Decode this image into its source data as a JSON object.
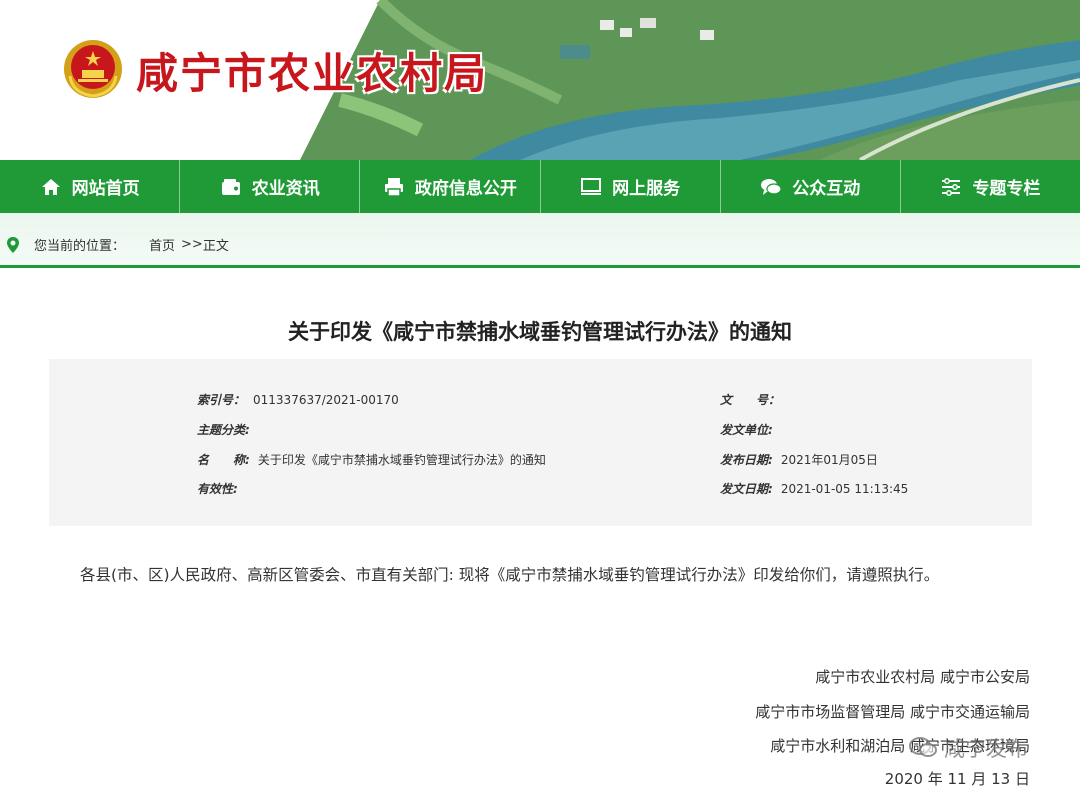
{
  "site": {
    "title": "咸宁市农业农村局"
  },
  "nav": [
    {
      "label": "网站首页",
      "icon": "home-icon"
    },
    {
      "label": "农业资讯",
      "icon": "wallet-icon"
    },
    {
      "label": "政府信息公开",
      "icon": "printer-icon"
    },
    {
      "label": "网上服务",
      "icon": "monitor-icon"
    },
    {
      "label": "公众互动",
      "icon": "chat-icon"
    },
    {
      "label": "专题专栏",
      "icon": "sliders-icon"
    }
  ],
  "breadcrumb": {
    "prefix": "您当前的位置：",
    "home": "首页",
    "separator": ">>",
    "current": "正文"
  },
  "article": {
    "title": "关于印发《咸宁市禁捕水域垂钓管理试行办法》的通知",
    "meta": {
      "index_label": "索引号：",
      "index_value": "011337637/2021-00170",
      "topic_label": "主题分类:",
      "topic_value": "",
      "name_label": "名　　称:",
      "name_value": "关于印发《咸宁市禁捕水域垂钓管理试行办法》的通知",
      "validity_label": "有效性:",
      "validity_value": "",
      "doc_no_label": "文　　号：",
      "doc_no_value": "",
      "issuer_label": "发文单位:",
      "issuer_value": "",
      "publish_label": "发布日期:",
      "publish_value": "2021年01月05日",
      "issue_date_label": "发文日期:",
      "issue_date_value": "2021-01-05 11:13:45"
    },
    "body": "各县(市、区)人民政府、高新区管委会、市直有关部门: 现将《咸宁市禁捕水域垂钓管理试行办法》印发给你们，请遵照执行。",
    "signatures": [
      "咸宁市农业农村局 咸宁市公安局",
      "咸宁市市场监督管理局 咸宁市交通运输局",
      "咸宁市水利和湖泊局 咸宁市生态环境局"
    ],
    "date": "2020 年 11 月 13 日"
  },
  "watermark": "咸宁发布",
  "colors": {
    "brand_green": "#1f9a36",
    "title_red": "#c8161d"
  }
}
